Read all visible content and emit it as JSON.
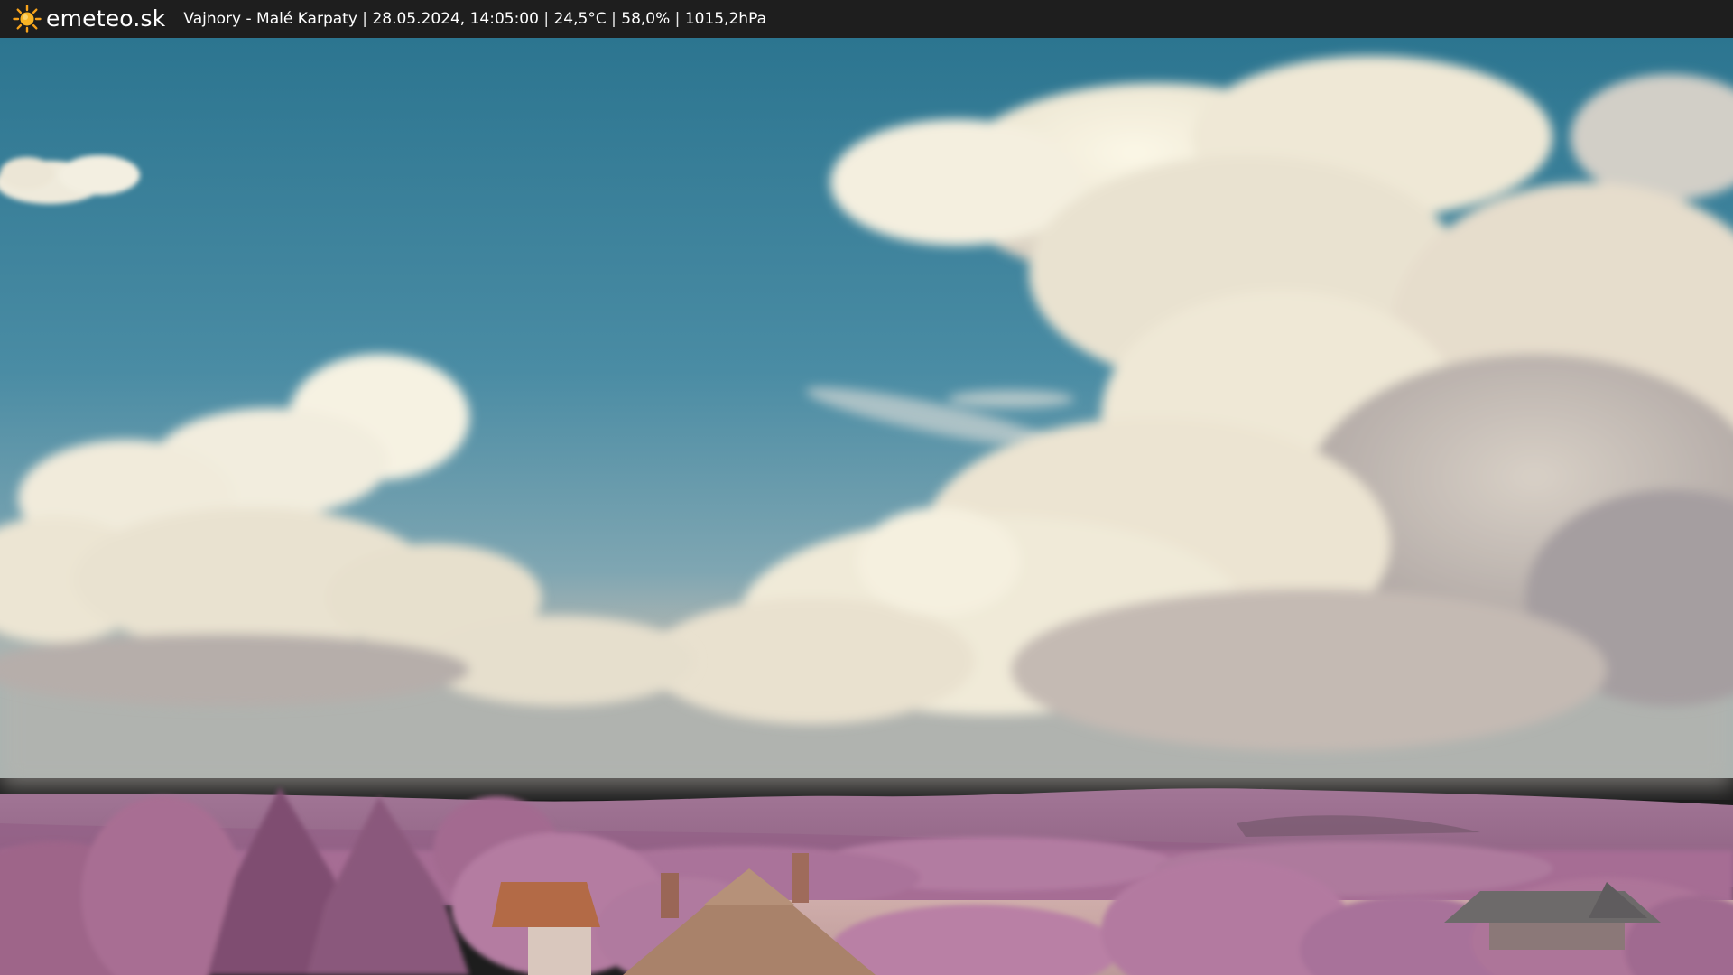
{
  "header": {
    "logo_icon": "sun-icon",
    "site_name": "emeteo.sk",
    "location": "Vajnory - Malé Karpaty",
    "datetime": "28.05.2024, 14:05:00",
    "temperature": "24,5°C",
    "humidity": "58,0%",
    "pressure": "1015,2hPa",
    "separator": " | "
  },
  "scene": {
    "description_icon": "webcam-image",
    "colors": {
      "sky_top": "#2f7891",
      "sky_mid": "#4d8fa6",
      "sky_horizon": "#8fb0ba",
      "cloud_light": "#f3eedb",
      "cloud_shadow": "#b9b0a8",
      "hills": "#9a6c8e",
      "foliage": "#b37a9e",
      "foliage_dark": "#7e4f70",
      "field": "#c9a6a6",
      "roof": "#b06a45",
      "roof_tan": "#a9826a"
    }
  }
}
